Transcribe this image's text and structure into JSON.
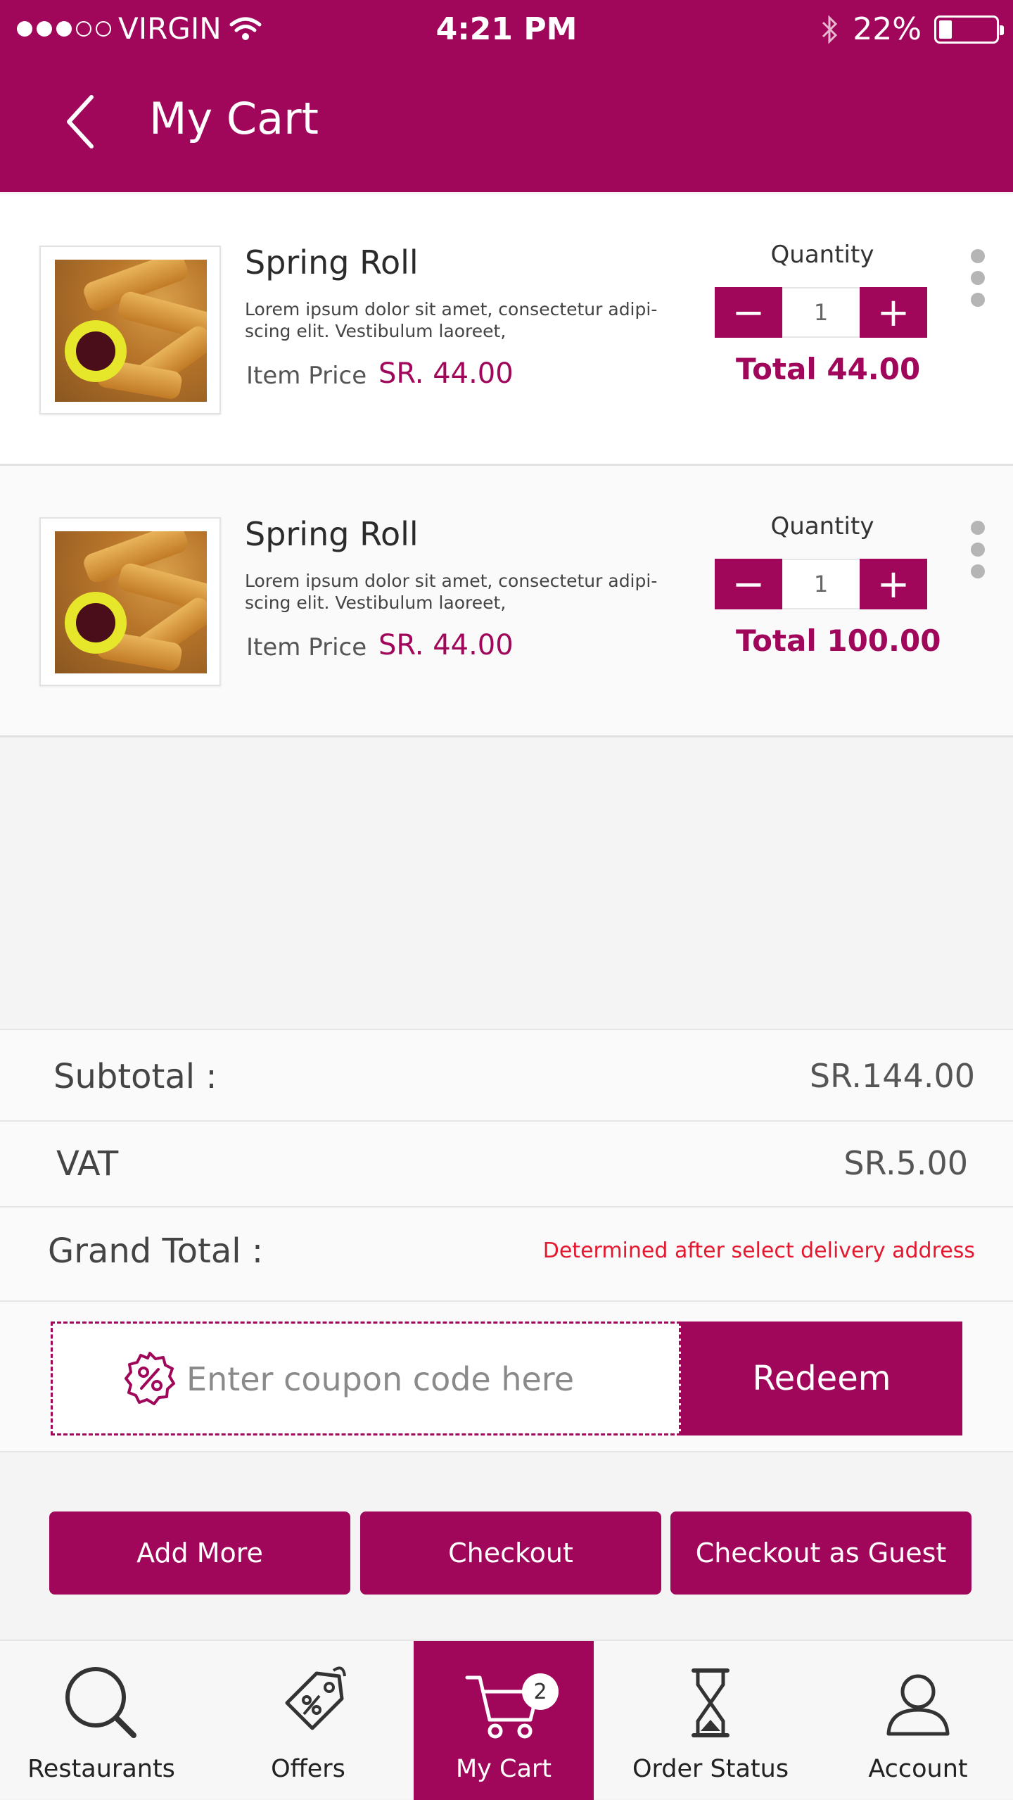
{
  "status_bar": {
    "carrier": "VIRGIN",
    "time": "4:21 PM",
    "battery": "22%",
    "icons": [
      "signal-dots-icon",
      "wifi-icon",
      "bluetooth-icon",
      "battery-icon"
    ]
  },
  "header": {
    "title": "My Cart",
    "back_icon": "chevron-left-icon"
  },
  "cart": {
    "quantity_label": "Quantity",
    "price_label": "Item Price",
    "items": [
      {
        "name": "Spring Roll",
        "description_line1": "Lorem ipsum dolor sit amet, consectetur adipi-",
        "description_line2": "scing elit. Vestibulum laoreet,",
        "price": "SR. 44.00",
        "quantity": "1",
        "total": "Total 44.00"
      },
      {
        "name": "Spring Roll",
        "description_line1": "Lorem ipsum dolor sit amet, consectetur adipi-",
        "description_line2": "scing elit. Vestibulum laoreet,",
        "price": "SR. 44.00",
        "quantity": "1",
        "total": "Total 100.00"
      }
    ],
    "stepper": {
      "minus": "−",
      "plus": "+"
    }
  },
  "summary": {
    "subtotal_label": "Subtotal :",
    "subtotal_value": "SR.144.00",
    "vat_label": "VAT",
    "vat_value": "SR.5.00",
    "grand_total_label": "Grand Total :",
    "grand_total_note": "Determined after select delivery address"
  },
  "coupon": {
    "placeholder": "Enter coupon code here",
    "redeem_label": "Redeem"
  },
  "actions": {
    "add_more": "Add More",
    "checkout": "Checkout",
    "checkout_guest": "Checkout as Guest"
  },
  "tabbar": {
    "tabs": [
      {
        "label": "Restaurants",
        "icon": "search-icon"
      },
      {
        "label": "Offers",
        "icon": "tag-icon"
      },
      {
        "label": "My Cart",
        "icon": "cart-icon",
        "badge": "2"
      },
      {
        "label": "Order Status",
        "icon": "hourglass-icon"
      },
      {
        "label": "Account",
        "icon": "user-icon"
      }
    ]
  },
  "colors": {
    "brand": "#a0075a",
    "alert": "#e4182e"
  }
}
